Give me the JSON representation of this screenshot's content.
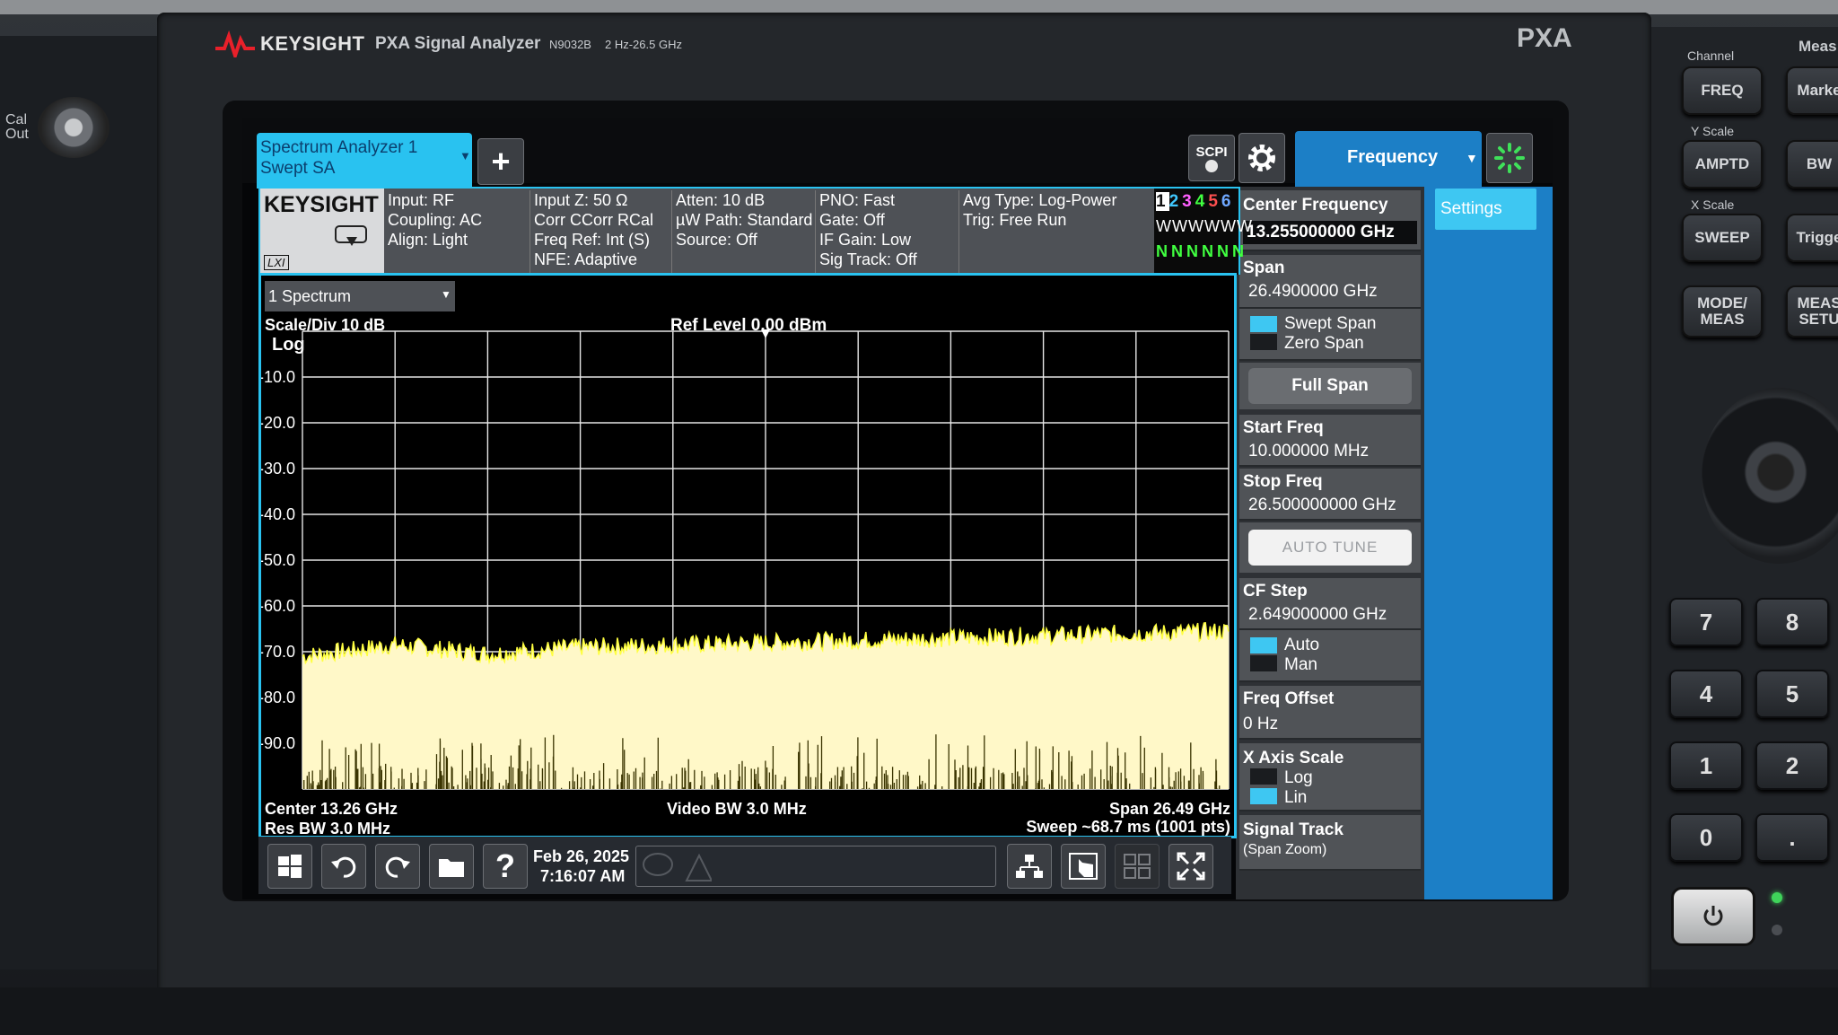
{
  "instrument": {
    "brand": "KEYSIGHT",
    "model_name": "PXA Signal Analyzer",
    "model_number": "N9032B",
    "freq_range": "2 Hz-26.5 GHz",
    "series_badge": "PXA",
    "cal_out": "Cal\nOut"
  },
  "hardware": {
    "group_channel": "Channel",
    "group_meas": "Meas",
    "group_yscale": "Y Scale",
    "group_xscale": "X Scale",
    "buttons": {
      "freq": "FREQ",
      "marker": "Marke",
      "ampt": "AMPTD",
      "bw": "BW",
      "sweep": "SWEEP",
      "trigger": "Trigge",
      "mode_meas": "MODE/ MEAS",
      "meas_setup": "MEAS SETU"
    },
    "keypad": [
      "7",
      "8",
      "4",
      "5",
      "1",
      "2",
      "0",
      "."
    ]
  },
  "header": {
    "mode_line1": "Spectrum Analyzer 1",
    "mode_line2": "Swept SA",
    "add_label": "+",
    "scpi": "SCPI",
    "menu_title": "Frequency",
    "settings_tab": "Settings"
  },
  "status": {
    "logo": "KEYSIGHT",
    "lxi": "LXI",
    "col1": [
      "Input: RF",
      "Coupling: AC",
      "Align: Light"
    ],
    "col2": [
      "Input Z: 50 Ω",
      "Corr CCorr RCal",
      "Freq Ref: Int (S)",
      "NFE: Adaptive"
    ],
    "col3": [
      "Atten: 10 dB",
      "µW Path: Standard",
      "Source: Off"
    ],
    "col4": [
      "PNO: Fast",
      "Gate: Off",
      "IF Gain: Low",
      "Sig Track: Off"
    ],
    "col5": [
      "Avg Type: Log-Power",
      "Trig: Free Run"
    ],
    "traces": [
      "1",
      "2",
      "3",
      "4",
      "5",
      "6"
    ],
    "trace_colors": [
      "#ffff40",
      "#3fc8ff",
      "#ff60ff",
      "#40ff40",
      "#ff5050",
      "#6fa8ff"
    ],
    "trace_types": [
      "W",
      "W",
      "W",
      "W",
      "W",
      "W"
    ],
    "trace_detectors": [
      "N",
      "N",
      "N",
      "N",
      "N",
      "N"
    ]
  },
  "plot": {
    "window_select": "1 Spectrum",
    "scale_div": "Scale/Div 10 dB",
    "scale_type": "Log",
    "ref_level": "Ref Level 0.00 dBm",
    "y_ticks": [
      "-10.0",
      "-20.0",
      "-30.0",
      "-40.0",
      "-50.0",
      "-60.0",
      "-70.0",
      "-80.0",
      "-90.0"
    ],
    "center": "Center 13.26 GHz",
    "res_bw": "Res BW 3.0 MHz",
    "video_bw": "Video BW 3.0 MHz",
    "span": "Span 26.49 GHz",
    "sweep": "Sweep ~68.7 ms (1001 pts)"
  },
  "chart_data": {
    "type": "line",
    "x": "frequency (GHz), 0.01 to 26.5",
    "ylim": [
      -100,
      0
    ],
    "y_unit": "dBm",
    "noise_floor_approx_dBm": [
      -71.5,
      -69,
      -71,
      -69.5,
      -69,
      -68.5,
      -68,
      -67.5,
      -67,
      -66.5,
      -66
    ],
    "trace_color": "#ffff40",
    "grid": true
  },
  "softkeys": {
    "center_freq_label": "Center Frequency",
    "center_freq_value": "13.255000000 GHz",
    "span_label": "Span",
    "span_value": "26.4900000 GHz",
    "swept_span": "Swept Span",
    "zero_span": "Zero Span",
    "full_span": "Full Span",
    "start_freq_label": "Start Freq",
    "start_freq_value": "10.000000 MHz",
    "stop_freq_label": "Stop Freq",
    "stop_freq_value": "26.500000000 GHz",
    "auto_tune": "AUTO TUNE",
    "cf_step_label": "CF Step",
    "cf_step_value": "2.649000000 GHz",
    "auto": "Auto",
    "man": "Man",
    "freq_offset_label": "Freq Offset",
    "freq_offset_value": "0 Hz",
    "x_axis_scale_label": "X Axis Scale",
    "log": "Log",
    "lin": "Lin",
    "signal_track_label": "Signal Track",
    "signal_track_sub": "(Span Zoom)"
  },
  "taskbar": {
    "date": "Feb 26, 2025",
    "time": "7:16:07 AM"
  }
}
